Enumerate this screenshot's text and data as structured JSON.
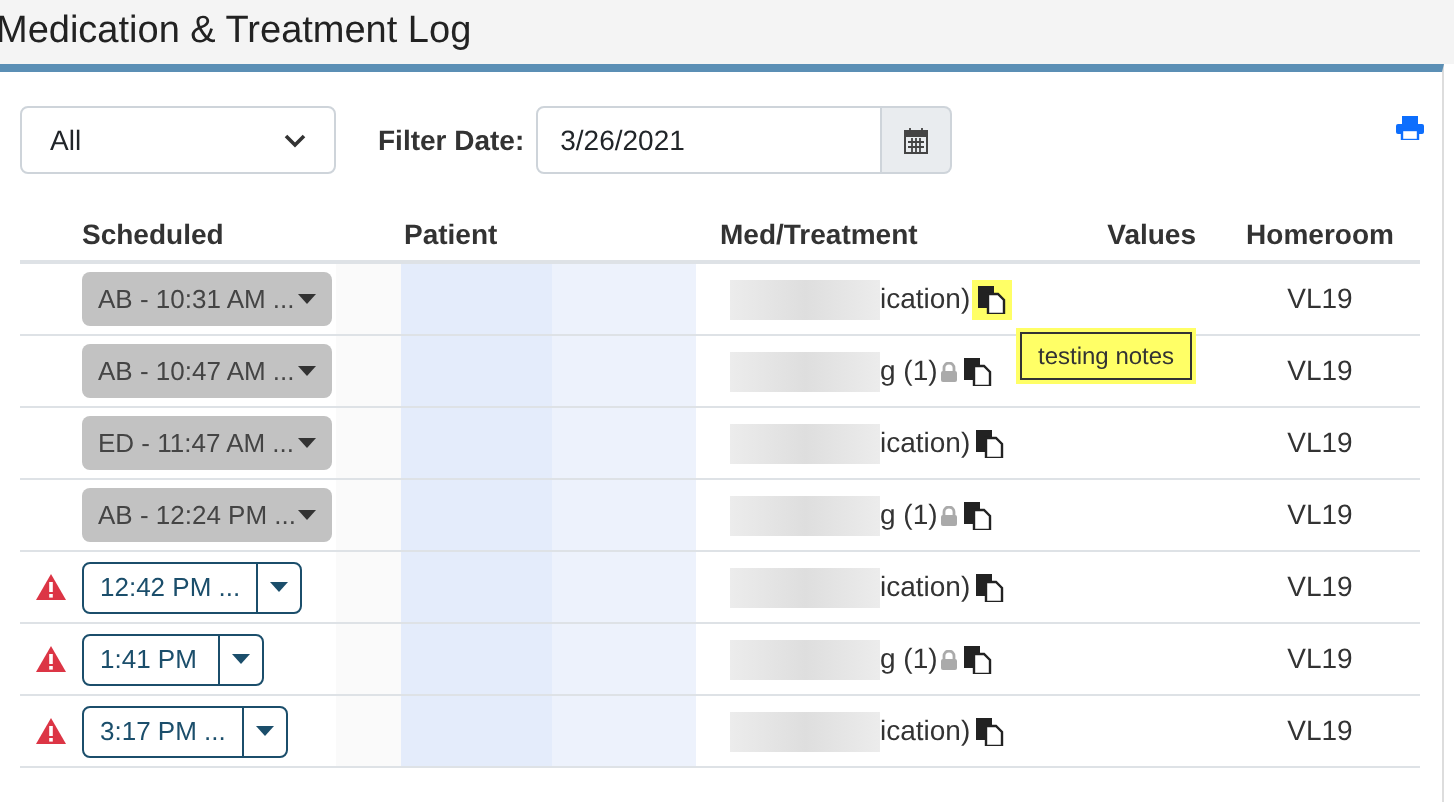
{
  "page_title": "Medication & Treatment Log",
  "filter": {
    "type": "All",
    "label": "Filter Date:",
    "date": "3/26/2021"
  },
  "columns": [
    "Scheduled",
    "Patient",
    "Med/Treatment",
    "Values",
    "Homeroom"
  ],
  "rows": [
    {
      "kind": "done",
      "time": "AB - 10:31 AM ...",
      "overdue": false,
      "med": "ication)",
      "locked": false,
      "highlighted": true,
      "homeroom": "VL19"
    },
    {
      "kind": "done",
      "time": "AB - 10:47 AM ...",
      "overdue": false,
      "med": "g (1)",
      "locked": true,
      "highlighted": false,
      "homeroom": "VL19"
    },
    {
      "kind": "done",
      "time": "ED - 11:47 AM ...",
      "overdue": false,
      "med": "ication)",
      "locked": false,
      "highlighted": false,
      "homeroom": "VL19"
    },
    {
      "kind": "done",
      "time": "AB - 12:24 PM ...",
      "overdue": false,
      "med": "g (1)",
      "locked": true,
      "highlighted": false,
      "homeroom": "VL19"
    },
    {
      "kind": "pending",
      "time": "12:42 PM ...",
      "overdue": true,
      "med": "ication)",
      "locked": false,
      "highlighted": false,
      "homeroom": "VL19"
    },
    {
      "kind": "pending",
      "time": "1:41 PM",
      "overdue": true,
      "med": "g (1)",
      "locked": true,
      "highlighted": false,
      "homeroom": "VL19"
    },
    {
      "kind": "pending",
      "time": "3:17 PM ...",
      "overdue": true,
      "med": "ication)",
      "locked": false,
      "highlighted": false,
      "homeroom": "VL19"
    }
  ],
  "tooltip": "testing notes"
}
